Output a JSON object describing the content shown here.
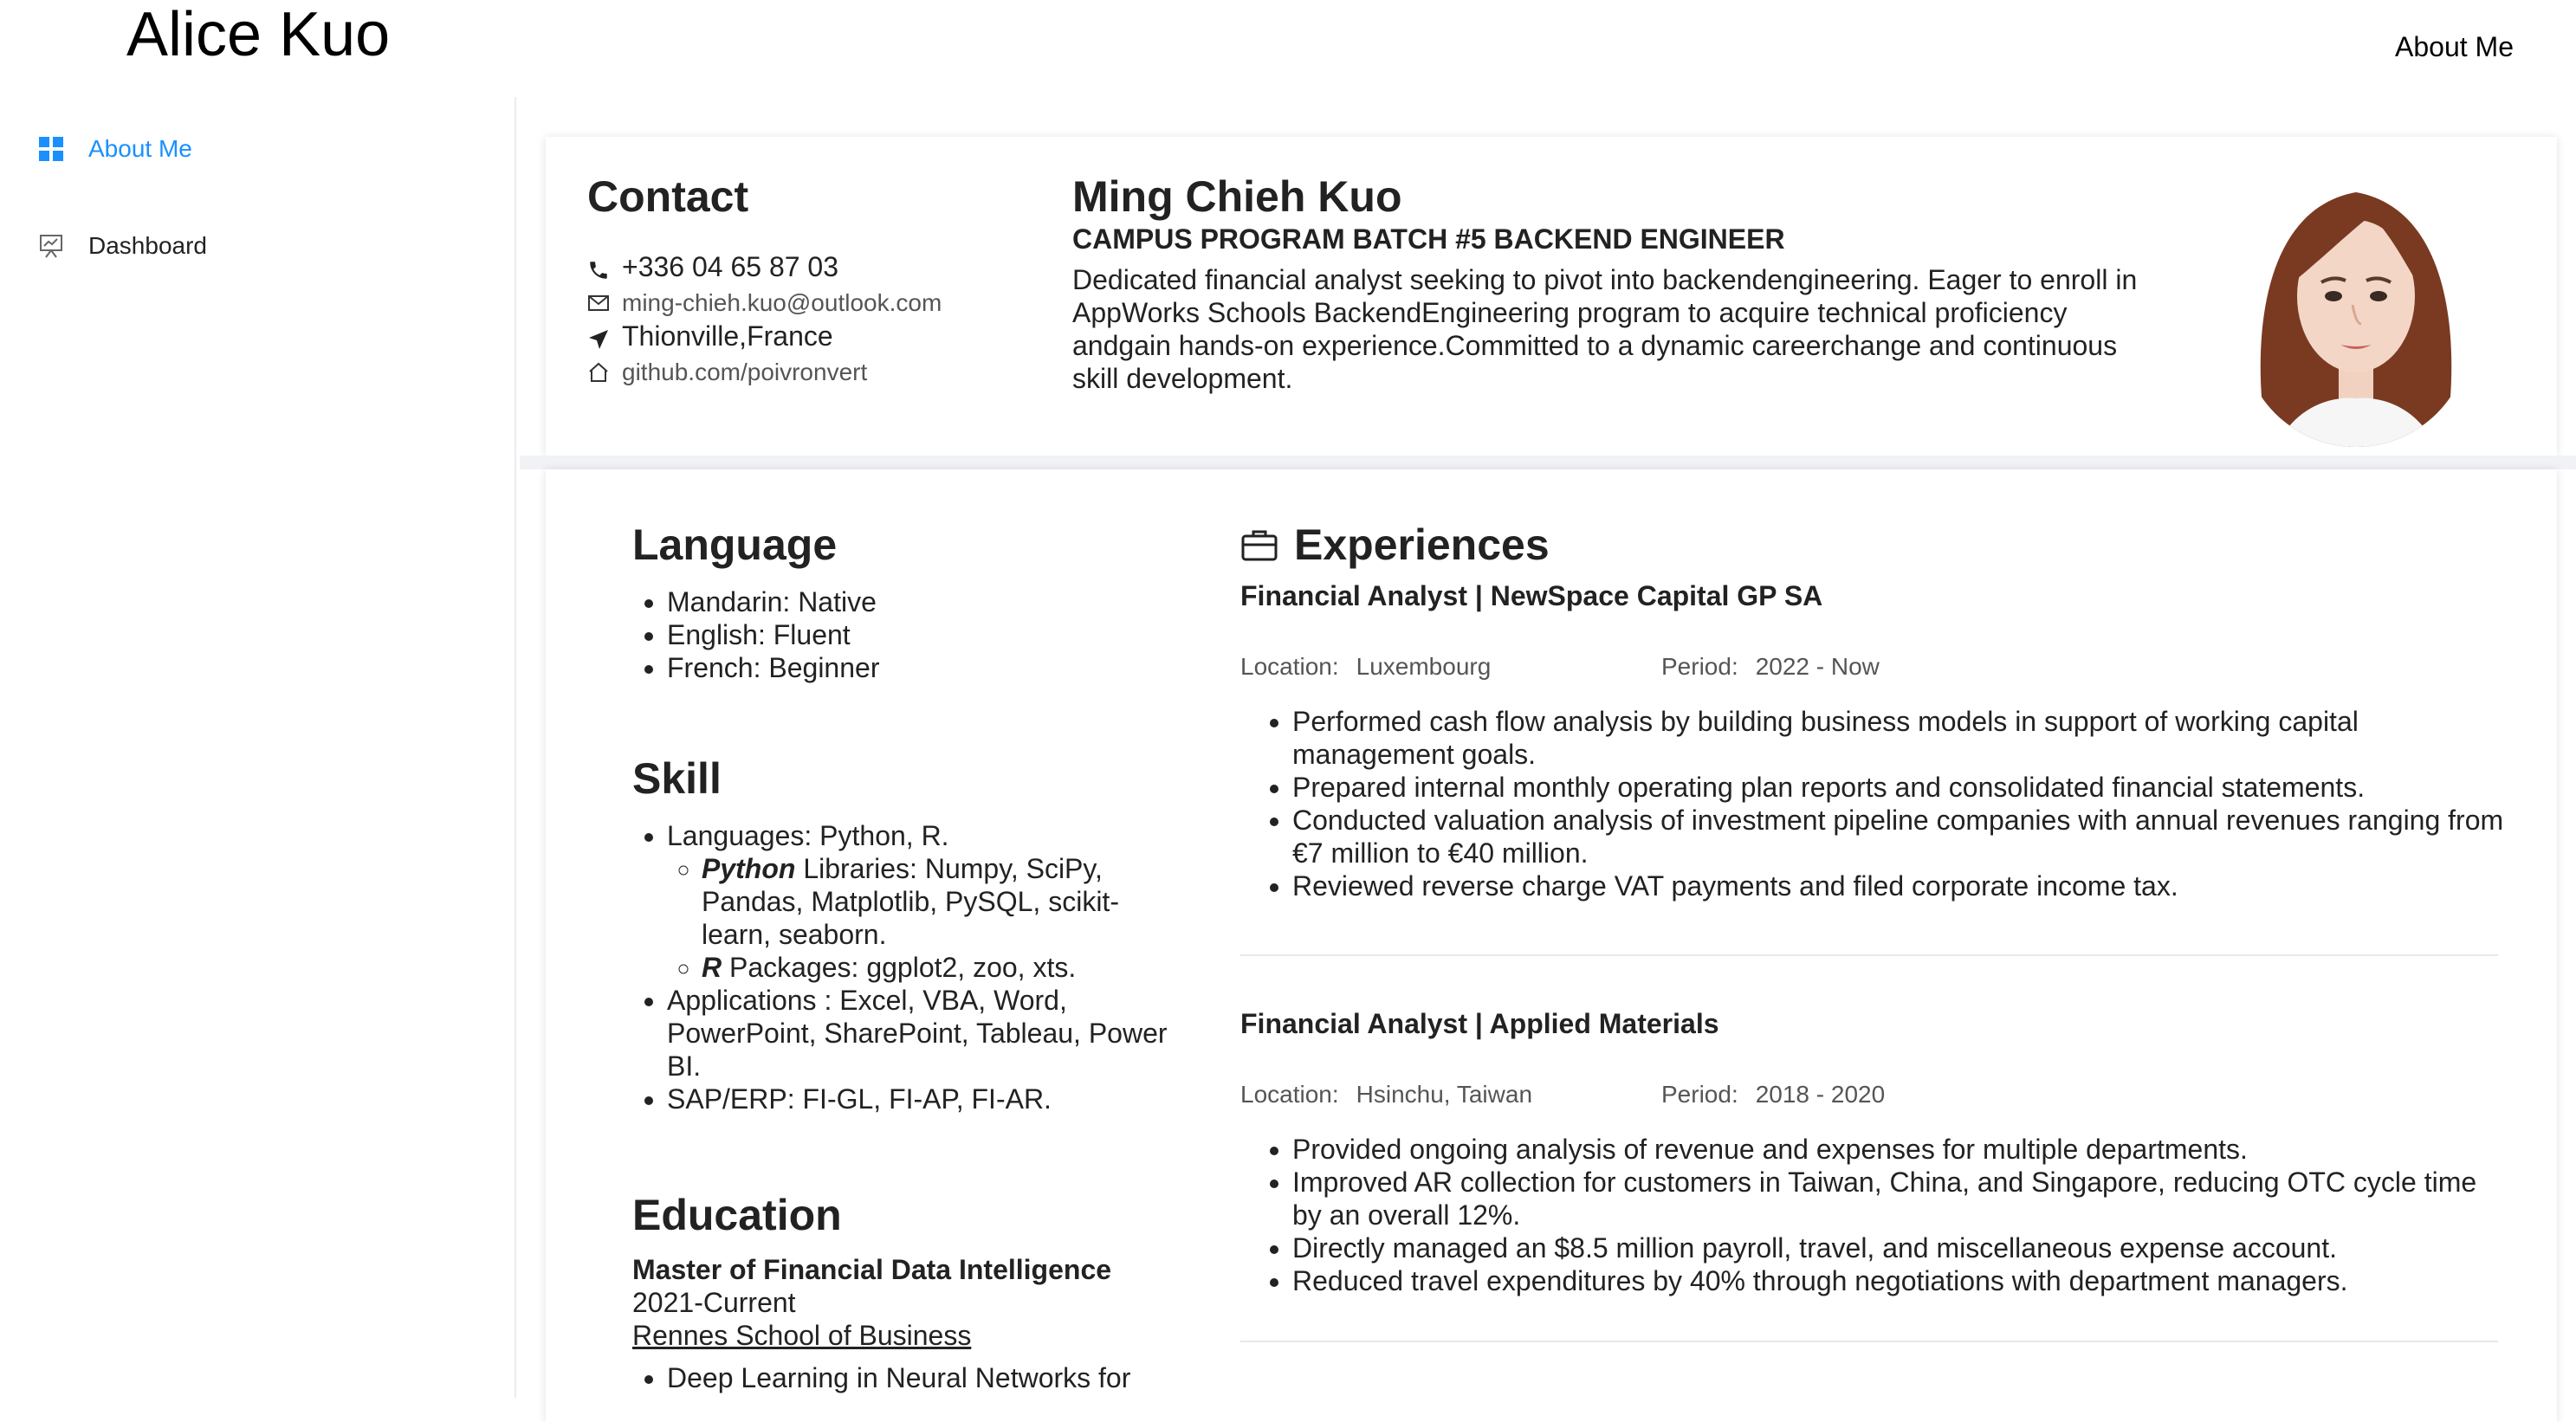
{
  "header": {
    "site_title": "Alice Kuo",
    "nav_about": "About Me"
  },
  "sidebar": {
    "items": [
      {
        "label": "About Me",
        "icon": "grid-icon",
        "active": true
      },
      {
        "label": "Dashboard",
        "icon": "presentation-chart-icon",
        "active": false
      }
    ]
  },
  "colors": {
    "accent": "#1a90ff",
    "text": "#222222",
    "muted": "#555555"
  },
  "contact": {
    "title": "Contact",
    "phone": "+336 04 65 87 03",
    "email": "ming-chieh.kuo@outlook.com",
    "location": "Thionville,France",
    "github": "github.com/poivronvert"
  },
  "profile": {
    "name": "Ming Chieh Kuo",
    "role": "CAMPUS PROGRAM BATCH #5 BACKEND ENGINEER",
    "summary": "Dedicated financial analyst seeking to pivot into backendengineering. Eager to enroll in AppWorks Schools BackendEngineering program to acquire technical proficiency andgain hands-on experience.Committed to a dynamic careerchange and continuous skill development."
  },
  "language": {
    "title": "Language",
    "items": [
      "Mandarin: Native",
      "English: Fluent",
      "French: Beginner"
    ]
  },
  "skill": {
    "title": "Skill",
    "languages": "Languages: Python, R.",
    "python_label": "Python",
    "python_text": " Libraries: Numpy, SciPy, Pandas, Matplotlib, PySQL, scikit-learn, seaborn.",
    "r_label": "R",
    "r_text": " Packages: ggplot2, zoo, xts.",
    "applications": "Applications : Excel, VBA, Word, PowerPoint, SharePoint, Tableau, Power BI.",
    "sap": "SAP/ERP: FI-GL, FI-AP, FI-AR."
  },
  "education": {
    "title": "Education",
    "degree": "Master of Financial Data Intelligence",
    "years": "2021-Current",
    "school": "Rennes School of Business",
    "items": [
      "Deep Learning in Neural Networks for"
    ]
  },
  "experiences": {
    "title": "Experiences",
    "location_label": "Location:",
    "period_label": "Period:",
    "jobs": [
      {
        "title": "Financial Analyst | NewSpace Capital GP SA",
        "location": "Luxembourg",
        "period": "2022 - Now",
        "bullets": [
          "Performed cash flow analysis by building business models in support of working capital management goals.",
          "Prepared internal monthly operating plan reports and consolidated financial statements.",
          "Conducted valuation analysis of investment pipeline companies with annual revenues ranging from €7 million to €40 million.",
          "Reviewed reverse charge VAT payments and filed corporate income tax."
        ]
      },
      {
        "title": "Financial Analyst | Applied Materials",
        "location": "Hsinchu, Taiwan",
        "period": "2018 - 2020",
        "bullets": [
          "Provided ongoing analysis of revenue and expenses for multiple departments.",
          "Improved AR collection for customers in Taiwan, China, and Singapore, reducing OTC cycle time by an overall 12%.",
          "Directly managed an $8.5 million payroll, travel, and miscellaneous expense account.",
          "Reduced travel expenditures by 40% through negotiations with department managers."
        ]
      }
    ]
  }
}
